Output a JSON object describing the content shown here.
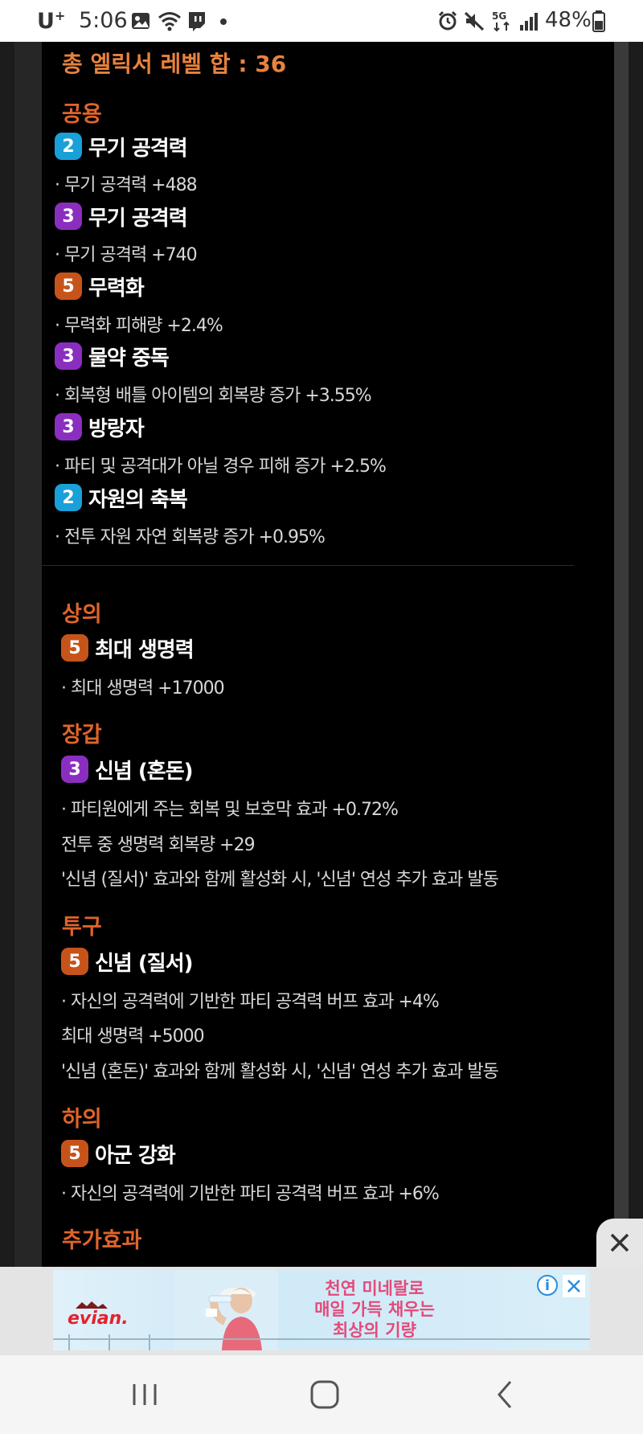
{
  "status_bar": {
    "carrier": "U",
    "carrier_sup": "+",
    "time": "5:06",
    "network": "5G",
    "battery": "48%"
  },
  "total_label": "총 엘릭서 레벨 합 : 36",
  "sections": [
    {
      "title": "공용",
      "skills": [
        {
          "level": "2",
          "name": "무기 공격력",
          "color": "#1aa0d8",
          "effects": [
            "· 무기 공격력 +488"
          ]
        },
        {
          "level": "3",
          "name": "무기 공격력",
          "color": "#8a2ec0",
          "effects": [
            "· 무기 공격력 +740"
          ]
        },
        {
          "level": "5",
          "name": "무력화",
          "color": "#c6541a",
          "effects": [
            "· 무력화 피해량 +2.4%"
          ]
        },
        {
          "level": "3",
          "name": "물약 중독",
          "color": "#8a2ec0",
          "effects": [
            "· 회복형 배틀 아이템의 회복량 증가 +3.55%"
          ]
        },
        {
          "level": "3",
          "name": "방랑자",
          "color": "#8a2ec0",
          "effects": [
            "· 파티 및 공격대가 아닐 경우 피해 증가 +2.5%"
          ]
        },
        {
          "level": "2",
          "name": "자원의 축복",
          "color": "#1aa0d8",
          "effects": [
            "· 전투 자원 자연 회복량 증가 +0.95%"
          ]
        }
      ]
    },
    {
      "title": "상의",
      "skills": [
        {
          "level": "5",
          "name": "최대 생명력",
          "color": "#c6541a",
          "effects": [
            "· 최대 생명력 +17000"
          ]
        }
      ]
    },
    {
      "title": "장갑",
      "skills": [
        {
          "level": "3",
          "name": "신념 (혼돈)",
          "color": "#8a2ec0",
          "effects": [
            "· 파티원에게 주는 회복 및 보호막 효과 +0.72%",
            "전투 중 생명력 회복량 +29",
            "'신념 (질서)' 효과와 함께 활성화 시, '신념' 연성 추가 효과 발동"
          ]
        }
      ]
    },
    {
      "title": "투구",
      "skills": [
        {
          "level": "5",
          "name": "신념 (질서)",
          "color": "#c6541a",
          "effects": [
            "· 자신의 공격력에 기반한 파티 공격력 버프 효과 +4%",
            "최대 생명력 +5000",
            "'신념 (혼돈)' 효과와 함께 활성화 시, '신념' 연성 추가 효과 발동"
          ]
        }
      ]
    },
    {
      "title": "하의",
      "skills": [
        {
          "level": "5",
          "name": "아군 강화",
          "color": "#c6541a",
          "effects": [
            "· 자신의 공격력에 기반한 파티 공격력 버프 효과 +6%"
          ]
        }
      ]
    },
    {
      "title": "추가효과",
      "skills": []
    }
  ],
  "ad": {
    "brand": "evian.",
    "copy_lines": [
      "천연 미네랄로",
      "매일 가득 채우는",
      "최상의 기량"
    ],
    "info_icon": "info-icon",
    "close_icon": "close-icon"
  },
  "navbar": {
    "recent": "recent-apps-icon",
    "home": "home-icon",
    "back": "back-icon"
  }
}
